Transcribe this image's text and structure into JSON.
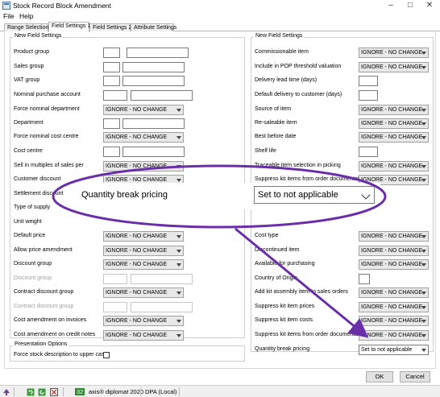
{
  "window": {
    "title": "Stock Record Block Amendment"
  },
  "menu": [
    "File",
    "Help"
  ],
  "tabs": [
    "Range Selection",
    "Field Settings 1",
    "Field Settings 2",
    "Attribute Settings"
  ],
  "active_tab": "Field Settings 1",
  "left_group": {
    "legend": "New Field Settings",
    "rows": [
      {
        "label": "Product group"
      },
      {
        "label": "Sales group"
      },
      {
        "label": "VAT group"
      },
      {
        "label": "Nominal purchase account"
      },
      {
        "label": "Force nominal department",
        "value": "IGNORE - NO CHANGE"
      },
      {
        "label": "Department"
      },
      {
        "label": "Force nominal cost centre",
        "value": "IGNORE - NO CHANGE"
      },
      {
        "label": "Cost centre"
      },
      {
        "label": "Sell in multiples of sales per",
        "value": "IGNORE - NO CHANGE"
      },
      {
        "label": "Customer discount",
        "value": "IGNORE - NO CHANGE"
      },
      {
        "label": "Settlement discount"
      },
      {
        "label": "Type of supply"
      },
      {
        "label": "Unit weight"
      },
      {
        "label": "Default price",
        "value": "IGNORE - NO CHANGE"
      },
      {
        "label": "Allow price amendment",
        "value": "IGNORE - NO CHANGE"
      },
      {
        "label": "Discount group",
        "value": "IGNORE - NO CHANGE"
      },
      {
        "label": "Discount group",
        "disabled": true
      },
      {
        "label": "Contract discount group",
        "value": "IGNORE - NO CHANGE"
      },
      {
        "label": "Contract discount group",
        "disabled": true
      },
      {
        "label": "Cost amendment on invoices",
        "value": "IGNORE - NO CHANGE"
      },
      {
        "label": "Cost amendment on credit notes",
        "value": "IGNORE - NO CHANGE"
      }
    ]
  },
  "right_group": {
    "legend": "New Field Settings",
    "rows": [
      {
        "label": "Commissionable item",
        "value": "IGNORE - NO CHANGE"
      },
      {
        "label": "Include in POP threshold valuation",
        "value": "IGNORE - NO CHANGE"
      },
      {
        "label": "Delivery lead time (days)"
      },
      {
        "label": "Default delivery to customer (days)"
      },
      {
        "label": "Source of item",
        "value": "IGNORE - NO CHANGE"
      },
      {
        "label": "Re-saleable item",
        "value": "IGNORE - NO CHANGE"
      },
      {
        "label": "Best before date",
        "value": "IGNORE - NO CHANGE"
      },
      {
        "label": "Shelf life"
      },
      {
        "label": "Traceable item selection in picking",
        "value": "IGNORE - NO CHANGE"
      },
      {
        "label": "Suppress kit items from order documentation",
        "value": "IGNORE - NO CHANGE"
      },
      {
        "label": ""
      },
      {
        "label": ""
      },
      {
        "label": ""
      },
      {
        "label": "Cost type",
        "value": "IGNORE - NO CHANGE"
      },
      {
        "label": "Discontinued item",
        "value": "IGNORE - NO CHANGE"
      },
      {
        "label": "Available for purchasing",
        "value": "IGNORE - NO CHANGE"
      },
      {
        "label": "Country of Origin"
      },
      {
        "label": "Add kit assembly item to sales orders",
        "value": "IGNORE - NO CHANGE"
      },
      {
        "label": "Suppress kit item prices",
        "value": "IGNORE - NO CHANGE"
      },
      {
        "label": "Suppress kit item costs",
        "value": "IGNORE - NO CHANGE"
      },
      {
        "label": "Suppress kit items from order documentation",
        "value": "IGNORE - NO CHANGE"
      },
      {
        "label": "Quantity break pricing",
        "value": "Set to not applicable"
      }
    ]
  },
  "presentation": {
    "legend": "Presentation Options",
    "checkbox_label": "Force stock description to upper case",
    "checked": false
  },
  "buttons": {
    "ok": "OK",
    "cancel": "Cancel"
  },
  "callout": {
    "label": "Quantity break pricing",
    "value": "Set to not applicable",
    "annotation_color": "#6a2fa8"
  },
  "statusbar": {
    "counter": "32",
    "product": "axis® diplomat 2020",
    "company": "DPA (Local)"
  }
}
